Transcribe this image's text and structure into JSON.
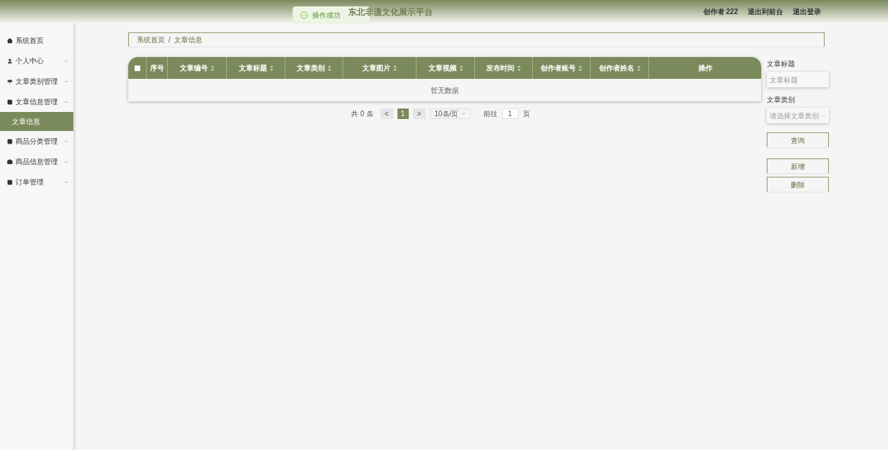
{
  "header": {
    "title": "东北非遗文化展示平台",
    "user": "创作者 222",
    "links": [
      "退出到前台",
      "退出登录"
    ]
  },
  "toast": {
    "message": "操作成功"
  },
  "sidebar": {
    "items": [
      {
        "label": "系统首页",
        "expandable": false
      },
      {
        "label": "个人中心",
        "expandable": true,
        "expanded": false
      },
      {
        "label": "文章类别管理",
        "expandable": true,
        "expanded": false
      },
      {
        "label": "文章信息管理",
        "expandable": true,
        "expanded": true,
        "children": [
          {
            "label": "文章信息",
            "selected": true
          }
        ]
      },
      {
        "label": "商品分类管理",
        "expandable": true,
        "expanded": false
      },
      {
        "label": "商品信息管理",
        "expandable": true,
        "expanded": false
      },
      {
        "label": "订单管理",
        "expandable": true,
        "expanded": false
      }
    ]
  },
  "breadcrumb": [
    "系统首页",
    "/",
    "文章信息"
  ],
  "table": {
    "select_all": {
      "checked": false
    },
    "columns": [
      {
        "label": "序号",
        "sortable": false
      },
      {
        "label": "文章编号",
        "sortable": true
      },
      {
        "label": "文章标题",
        "sortable": true
      },
      {
        "label": "文章类别",
        "sortable": true
      },
      {
        "label": "文章图片",
        "sortable": true
      },
      {
        "label": "文章视频",
        "sortable": true
      },
      {
        "label": "发布时间",
        "sortable": true
      },
      {
        "label": "创作者账号",
        "sortable": true
      },
      {
        "label": "创作者姓名",
        "sortable": true
      },
      {
        "label": "操作",
        "sortable": false
      }
    ],
    "empty_text": "暂无数据"
  },
  "pagination": {
    "total": "共 0 条",
    "prev": "<",
    "pages": [
      {
        "label": "1",
        "selected": true
      }
    ],
    "next": ">",
    "page_size": "10条/页",
    "goto_label": "前往",
    "goto_value": "1",
    "goto_suffix": "页"
  },
  "filters": [
    {
      "label": "文章标题",
      "kind": "text",
      "placeholder": "文章标题"
    },
    {
      "label": "文章类别",
      "kind": "select",
      "placeholder": "请选择文章类别"
    }
  ],
  "buttons": [
    {
      "label": "查询"
    },
    {
      "label": "新增"
    },
    {
      "label": "删除"
    }
  ]
}
